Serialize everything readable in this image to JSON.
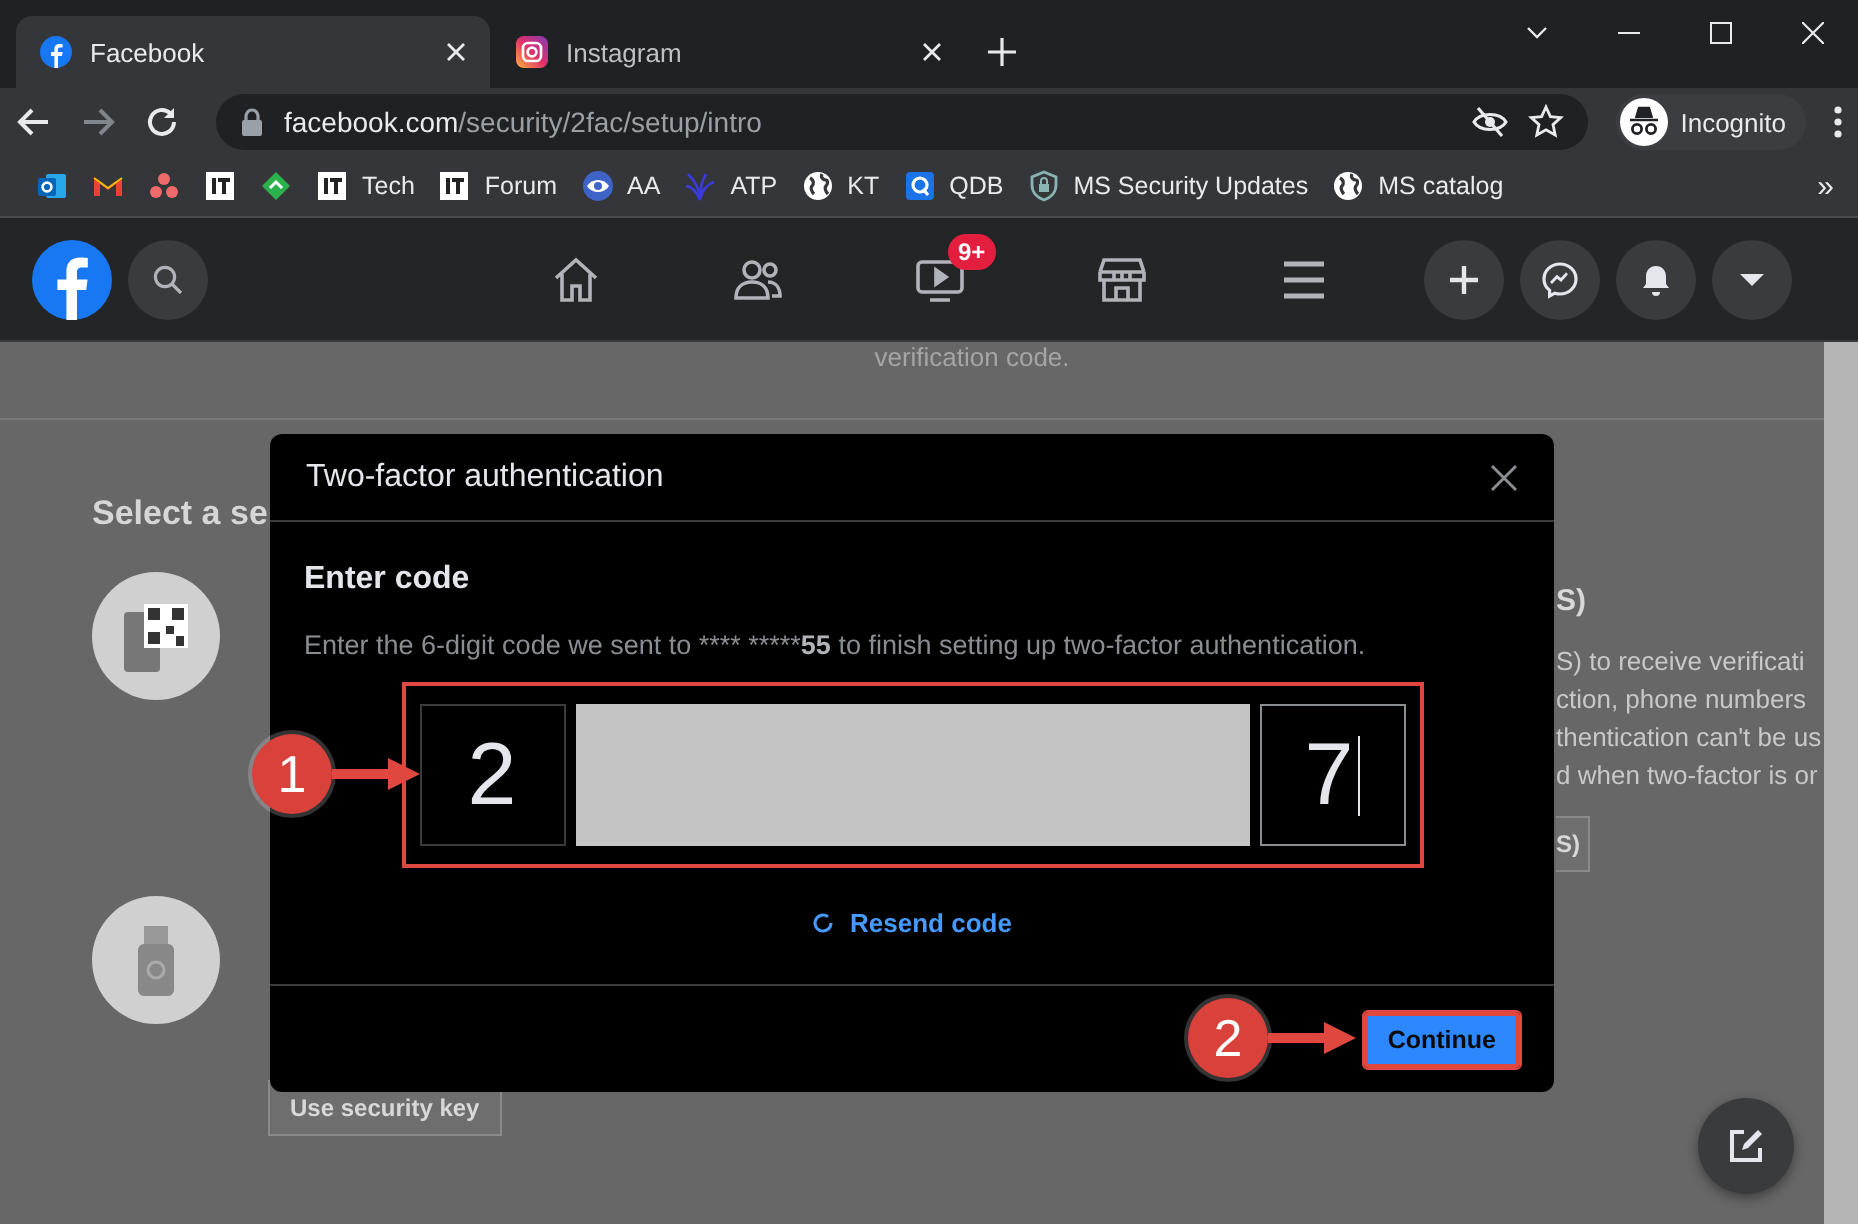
{
  "browser": {
    "tabs": [
      {
        "title": "Facebook",
        "kind": "facebook",
        "selected": true
      },
      {
        "title": "Instagram",
        "kind": "instagram",
        "selected": false
      }
    ],
    "url": {
      "host": "facebook.com",
      "path": "/security/2fac/setup/intro"
    },
    "profile": "Incognito",
    "bookmarks": [
      {
        "kind": "outlook"
      },
      {
        "kind": "gmail"
      },
      {
        "kind": "dots"
      },
      {
        "kind": "square"
      },
      {
        "kind": "leaf"
      },
      {
        "kind": "square",
        "label": "Tech"
      },
      {
        "kind": "square",
        "label": "Forum"
      },
      {
        "kind": "eye",
        "label": "AA"
      },
      {
        "kind": "plant",
        "label": "ATP"
      },
      {
        "kind": "globe",
        "label": "KT"
      },
      {
        "kind": "qbox",
        "label": "QDB"
      },
      {
        "kind": "shield",
        "label": "MS Security Updates"
      },
      {
        "kind": "globe",
        "label": "MS catalog"
      }
    ],
    "bookmarks_overflow": "»"
  },
  "nav": {
    "items": [
      {
        "kind": "home"
      },
      {
        "kind": "friends"
      },
      {
        "kind": "watch",
        "badge": "9+"
      },
      {
        "kind": "market"
      },
      {
        "kind": "menu"
      }
    ],
    "actions": [
      {
        "kind": "plus"
      },
      {
        "kind": "messenger"
      },
      {
        "kind": "bell"
      },
      {
        "kind": "caret"
      }
    ]
  },
  "page": {
    "top_text": "verification code.",
    "section_title": "Select a se",
    "right_title": "S)",
    "right_lines": [
      "S) to receive verificati",
      "ction, phone numbers",
      "thentication can't be us",
      "d when two-factor is or"
    ],
    "right_button": "S)",
    "security_key_button": "Use security key"
  },
  "dialog": {
    "title": "Two-factor authentication",
    "heading": "Enter code",
    "description": {
      "before": "Enter the 6-digit code we sent to **** *****",
      "bold": "55",
      "after": " to finish setting up two-factor authentication."
    },
    "code_highlighted": true,
    "code_boxes": [
      {
        "value": "2",
        "redacted": false,
        "focused": false
      },
      {
        "redacted": true
      },
      {
        "redacted": true
      },
      {
        "redacted": true
      },
      {
        "redacted": true
      },
      {
        "value": "7",
        "redacted": false,
        "focused": true
      }
    ],
    "resend": "Resend code",
    "continue": {
      "label": "Continue",
      "highlighted": true
    }
  },
  "annotations": [
    {
      "label": "1"
    },
    {
      "label": "2"
    }
  ]
}
